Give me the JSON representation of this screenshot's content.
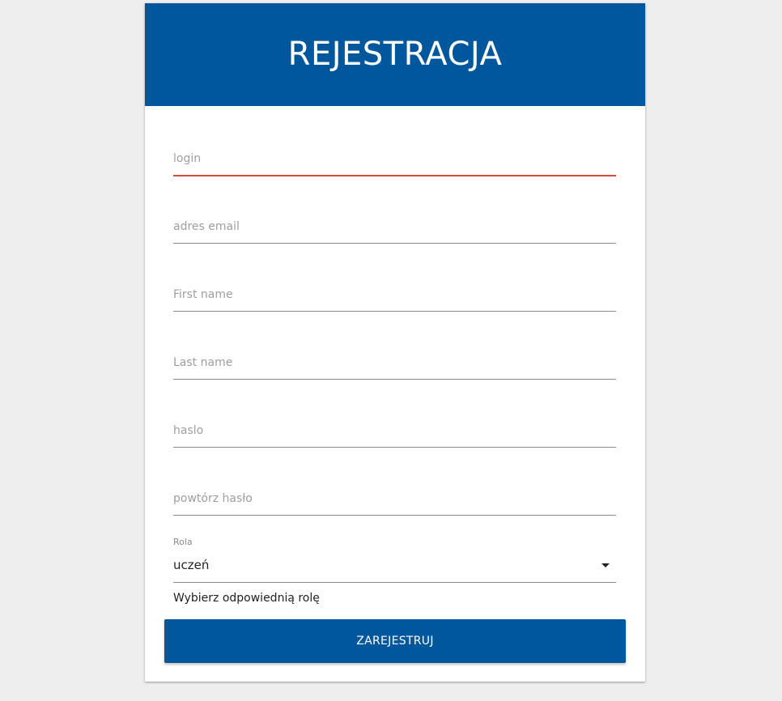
{
  "form": {
    "title": "REJESTRACJA",
    "fields": [
      {
        "name": "login",
        "placeholder": "login",
        "value": ""
      },
      {
        "name": "email",
        "placeholder": "adres email",
        "value": ""
      },
      {
        "name": "first_name",
        "placeholder": "First name",
        "value": ""
      },
      {
        "name": "last_name",
        "placeholder": "Last name",
        "value": ""
      },
      {
        "name": "password",
        "placeholder": "haslo",
        "value": ""
      },
      {
        "name": "password_repeat",
        "placeholder": "powtórz hasło",
        "value": ""
      }
    ],
    "role": {
      "label": "Rola",
      "selected": "uczeń",
      "helper": "Wybierz odpowiednią rolę"
    },
    "submit_label": "ZAREJESTRUJ"
  },
  "colors": {
    "primary": "#01579b",
    "error_underline": "#d84a3a",
    "background": "#eeeeee"
  },
  "icons": {
    "role_dropdown": "caret-down-icon"
  }
}
